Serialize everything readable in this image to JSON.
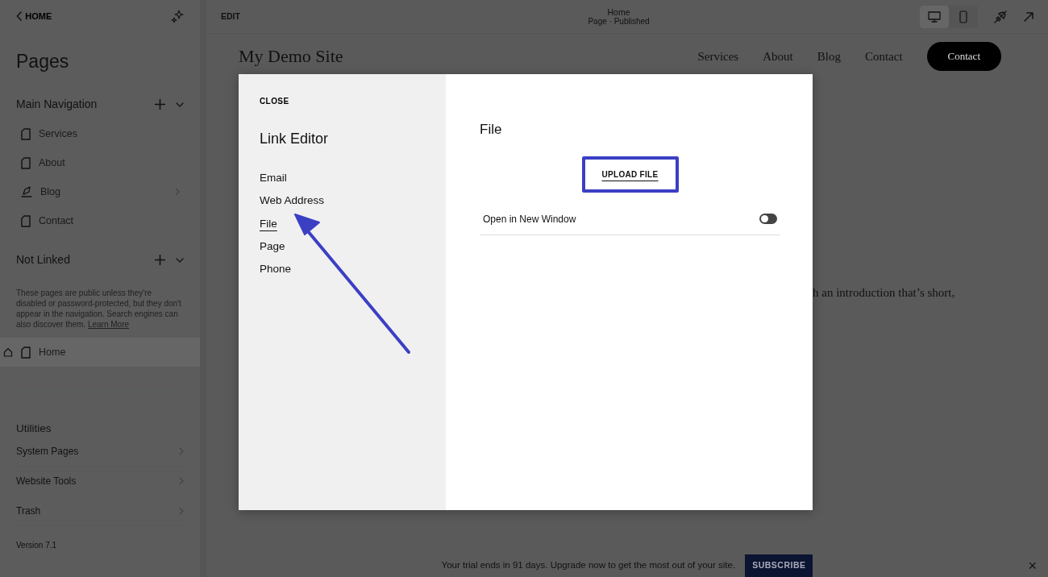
{
  "sidebar": {
    "back": "HOME",
    "title": "Pages",
    "sections": [
      {
        "title": "Main Navigation",
        "expanded": true,
        "items": [
          {
            "label": "Services",
            "kind": "page",
            "home": false,
            "selected": false,
            "has_children": false
          },
          {
            "label": "About",
            "kind": "page",
            "home": false,
            "selected": false,
            "has_children": false
          },
          {
            "label": "Blog",
            "kind": "blog",
            "home": false,
            "selected": false,
            "has_children": true
          },
          {
            "label": "Contact",
            "kind": "page",
            "home": false,
            "selected": false,
            "has_children": false
          }
        ]
      },
      {
        "title": "Not Linked",
        "expanded": true,
        "note": "These pages are public unless they're disabled or password-protected, but they don't appear in the navigation. Search engines can also discover them.",
        "note_link": "Learn More",
        "items": [
          {
            "label": "Home",
            "kind": "page",
            "home": true,
            "selected": true,
            "has_children": false
          }
        ]
      }
    ],
    "utilities": {
      "title": "Utilities",
      "items": [
        "System Pages",
        "Website Tools",
        "Trash"
      ]
    },
    "version": "Version 7.1"
  },
  "topbar": {
    "mode": "EDIT",
    "page_title": "Home",
    "page_status": "Page · Published",
    "devices": [
      {
        "kind": "desktop",
        "selected": true
      },
      {
        "kind": "mobile",
        "selected": false
      }
    ]
  },
  "preview": {
    "site_title": "My Demo Site",
    "nav": [
      "Services",
      "About",
      "Blog",
      "Contact"
    ],
    "cta": "Contact",
    "body_text": "h an introduction that’s short,"
  },
  "modal": {
    "close": "CLOSE",
    "title": "Link Editor",
    "types": [
      {
        "label": "Email",
        "selected": false
      },
      {
        "label": "Web Address",
        "selected": false
      },
      {
        "label": "File",
        "selected": true
      },
      {
        "label": "Page",
        "selected": false
      },
      {
        "label": "Phone",
        "selected": false
      }
    ],
    "panel_title": "File",
    "upload": "UPLOAD FILE",
    "upload_highlighted": true,
    "option": {
      "label": "Open in New Window",
      "on": false
    }
  },
  "banner": {
    "text": "Your trial ends in 91 days. Upgrade now to get the most out of your site.",
    "button": "SUBSCRIBE",
    "close": "×"
  }
}
